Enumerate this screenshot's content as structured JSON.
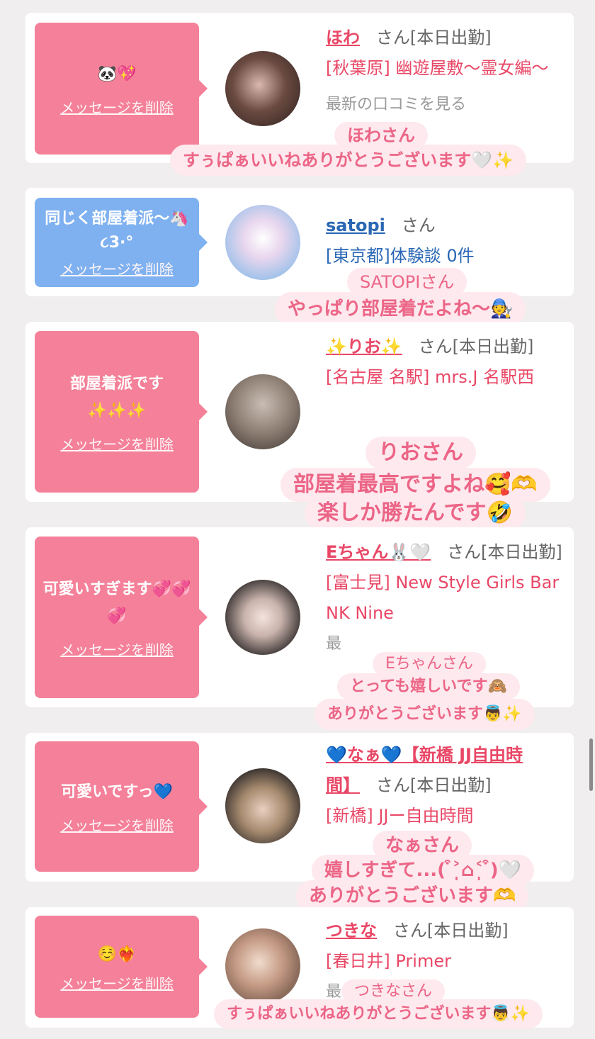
{
  "cards": [
    {
      "message": "🐼💖",
      "delete_label": "メッセージを削除",
      "name": "ほわ",
      "honorific": "さん[本日出勤]",
      "shop": "[秋葉原] 幽遊屋敷〜霊女編〜",
      "more": "最新の口コミを見る",
      "overlay": [
        "ほわさん",
        "すぅぱぁいいねありがとうございます🤍✨"
      ]
    },
    {
      "message": "同じく部屋着派〜🦄૮3·°",
      "delete_label": "メッセージを削除",
      "name": "satopi",
      "honorific": "さん",
      "shop": "[東京都]体験談 0件",
      "overlay": [
        "SATOPIさん",
        "やっぱり部屋着だよね〜🧑‍🔧"
      ]
    },
    {
      "message": "部屋着派です✨✨✨",
      "delete_label": "メッセージを削除",
      "name": "✨りお✨",
      "honorific": "さん[本日出勤]",
      "shop": "[名古屋 名駅] mrs.J 名駅西",
      "overlay": [
        "りおさん",
        "部屋着最高ですよね🥰🫶",
        "楽しか勝たんです🤣"
      ]
    },
    {
      "message": "可愛いすぎます💞💞💞",
      "delete_label": "メッセージを削除",
      "name": "Eちゃん🐰🤍",
      "honorific": "さん[本日出勤]",
      "shop": "[富士見] New Style Girls Bar NK Nine",
      "more": "最",
      "overlay": [
        "Eちゃんさん",
        "とっても嬉しいです🙈",
        "ありがとうございます👼✨"
      ]
    },
    {
      "message": "可愛いですっ💙",
      "delete_label": "メッセージを削除",
      "name": "💙なぁ💙【新橋 JJ自由時間】",
      "honorific": "さん[本日出勤]",
      "shop": "[新橋] JJー自由時間",
      "overlay": [
        "なぁさん",
        "嬉しすぎて...( ͒˃̩̩⌂˂̩̩ ͒)🤍",
        "ありがとうございます🫶"
      ]
    },
    {
      "message": "☺️❤️‍🔥",
      "delete_label": "メッセージを削除",
      "name": "つきな",
      "honorific": "さん[本日出勤]",
      "shop": "[春日井] Primer",
      "more": "最",
      "overlay": [
        "つきなさん",
        "すぅぱぁいいねありがとうございます👼✨"
      ]
    }
  ],
  "colors": {
    "pink_box": "#f48199",
    "blue_box": "#7fb1f0",
    "name_pink": "#e94766",
    "name_blue": "#2a67b4",
    "bubble_bg": "#fde9ee",
    "bubble_text": "#ec6586"
  }
}
